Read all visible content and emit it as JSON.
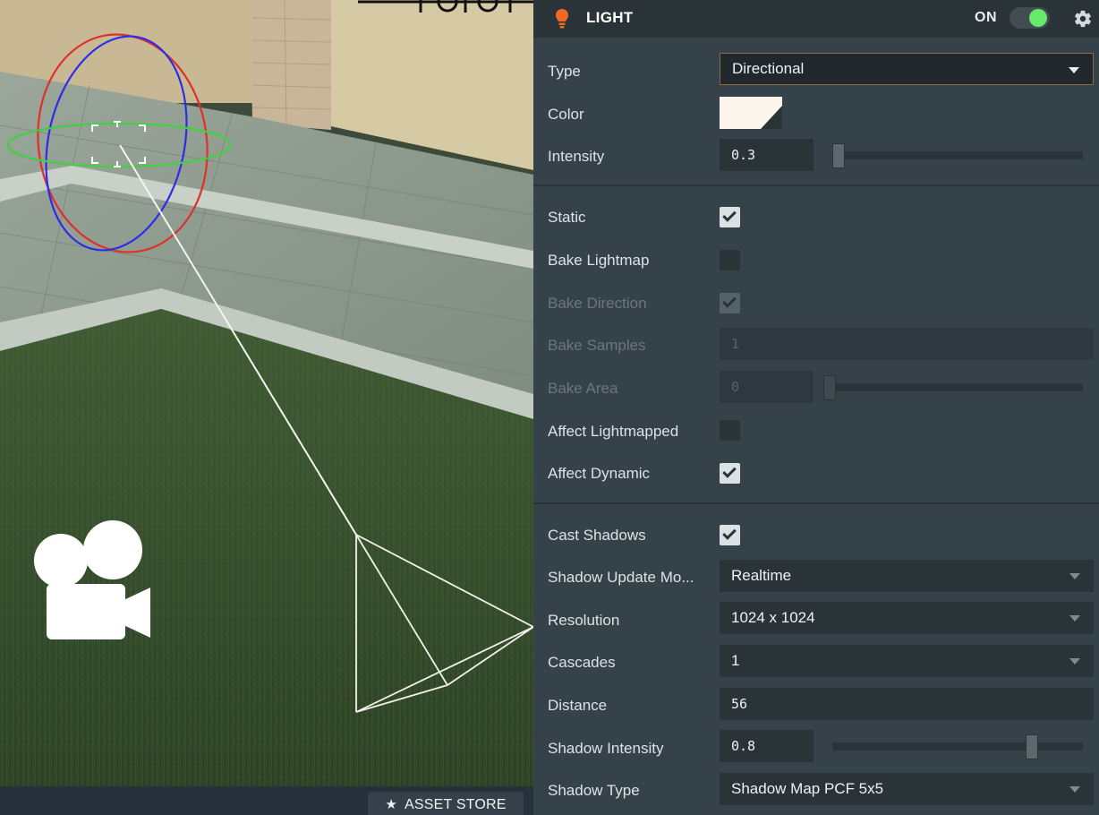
{
  "viewport": {
    "asset_store_label": "ASSET STORE",
    "star_glyph": "★"
  },
  "panel": {
    "title": "LIGHT",
    "toggle_label": "ON",
    "toggle_on": true,
    "toggle_color": "#66ea6a",
    "accent_icon_color": "#f06a24"
  },
  "fields": {
    "type": {
      "label": "Type",
      "value": "Directional"
    },
    "color": {
      "label": "Color",
      "value": "#fcf6ec"
    },
    "intensity": {
      "label": "Intensity",
      "value": "0.3"
    },
    "static": {
      "label": "Static",
      "checked": true
    },
    "bake_lightmap": {
      "label": "Bake Lightmap",
      "checked": false
    },
    "bake_direction": {
      "label": "Bake Direction",
      "checked": true,
      "disabled": true
    },
    "bake_samples": {
      "label": "Bake Samples",
      "value": "1",
      "disabled": true
    },
    "bake_area": {
      "label": "Bake Area",
      "value": "0",
      "disabled": true
    },
    "affect_lightmapped": {
      "label": "Affect Lightmapped",
      "checked": false
    },
    "affect_dynamic": {
      "label": "Affect Dynamic",
      "checked": true
    },
    "cast_shadows": {
      "label": "Cast Shadows",
      "checked": true
    },
    "shadow_update_mode": {
      "label": "Shadow Update Mo...",
      "value": "Realtime"
    },
    "resolution": {
      "label": "Resolution",
      "value": "1024 x 1024"
    },
    "cascades": {
      "label": "Cascades",
      "value": "1"
    },
    "distance": {
      "label": "Distance",
      "value": "56"
    },
    "shadow_intensity": {
      "label": "Shadow Intensity",
      "value": "0.8"
    },
    "shadow_type": {
      "label": "Shadow Type",
      "value": "Shadow Map PCF 5x5"
    }
  },
  "icons": {
    "light": "lightbulb-icon",
    "gear": "gear-icon",
    "camera": "camera-icon",
    "star": "star-icon"
  }
}
